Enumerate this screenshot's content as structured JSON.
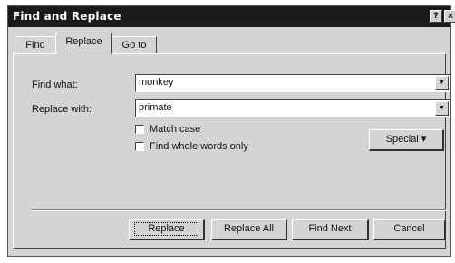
{
  "window": {
    "title": "Find and Replace",
    "help_glyph": "?",
    "close_glyph": "×"
  },
  "tabs": [
    {
      "label": "Find",
      "active": false
    },
    {
      "label": "Replace",
      "active": true
    },
    {
      "label": "Go to",
      "active": false
    }
  ],
  "form": {
    "find_label": "Find what:",
    "find_value": "monkey",
    "replace_label": "Replace with:",
    "replace_value": "primate",
    "dropdown_glyph": "▼",
    "match_case_label": "Match case",
    "match_case_checked": false,
    "whole_words_label": "Find whole words only",
    "whole_words_checked": false
  },
  "buttons": {
    "special": "Special  ▾",
    "replace": "Replace",
    "replace_all": "Replace All",
    "find_next": "Find Next",
    "cancel": "Cancel"
  }
}
